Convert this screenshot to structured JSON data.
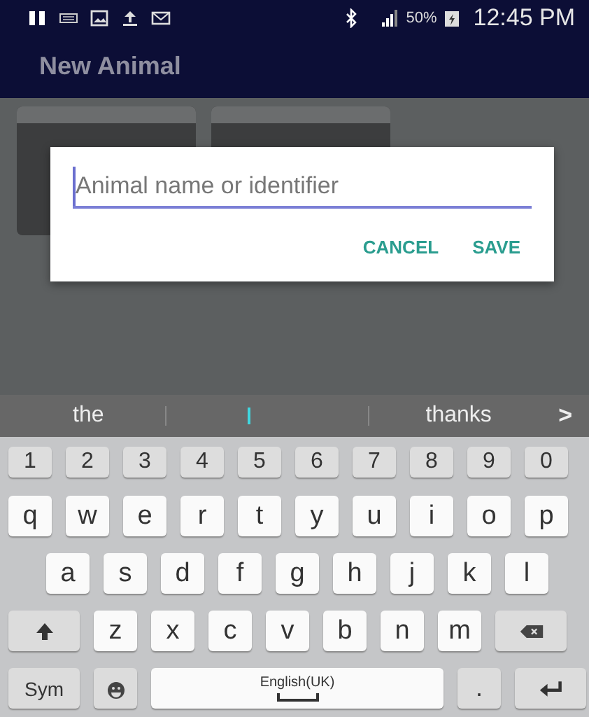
{
  "status_bar": {
    "battery_text": "50%",
    "time": "12:45 PM"
  },
  "app_bar": {
    "title": "New Animal"
  },
  "dialog": {
    "field": {
      "placeholder": "Animal name or identifier",
      "focused": true
    },
    "buttons": [
      "CANCEL",
      "SAVE"
    ]
  },
  "suggestions": {
    "items": [
      "the",
      "thanks"
    ],
    "more": ">"
  },
  "keyboard": {
    "rows": [
      {
        "kind": "numbers",
        "keys": [
          {
            "kind": "char",
            "label": "1"
          },
          {
            "kind": "char",
            "label": "2"
          },
          {
            "kind": "char",
            "label": "3"
          },
          {
            "kind": "char",
            "label": "4"
          },
          {
            "kind": "char",
            "label": "5"
          },
          {
            "kind": "char",
            "label": "6"
          },
          {
            "kind": "char",
            "label": "7"
          },
          {
            "kind": "char",
            "label": "8"
          },
          {
            "kind": "char",
            "label": "9"
          },
          {
            "kind": "char",
            "label": "0"
          }
        ]
      },
      {
        "kind": "letters",
        "keys": [
          {
            "kind": "char",
            "label": "q"
          },
          {
            "kind": "char",
            "label": "w"
          },
          {
            "kind": "char",
            "label": "e"
          },
          {
            "kind": "char",
            "label": "r"
          },
          {
            "kind": "char",
            "label": "t"
          },
          {
            "kind": "char",
            "label": "y"
          },
          {
            "kind": "char",
            "label": "u"
          },
          {
            "kind": "char",
            "label": "i"
          },
          {
            "kind": "char",
            "label": "o"
          },
          {
            "kind": "char",
            "label": "p"
          }
        ]
      },
      {
        "kind": "letters",
        "keys": [
          {
            "kind": "char",
            "label": "a"
          },
          {
            "kind": "char",
            "label": "s"
          },
          {
            "kind": "char",
            "label": "d"
          },
          {
            "kind": "char",
            "label": "f"
          },
          {
            "kind": "char",
            "label": "g"
          },
          {
            "kind": "char",
            "label": "h"
          },
          {
            "kind": "char",
            "label": "j"
          },
          {
            "kind": "char",
            "label": "k"
          },
          {
            "kind": "char",
            "label": "l"
          }
        ]
      },
      {
        "kind": "letters",
        "keys": [
          {
            "kind": "shift"
          },
          {
            "kind": "char",
            "label": "z"
          },
          {
            "kind": "char",
            "label": "x"
          },
          {
            "kind": "char",
            "label": "c"
          },
          {
            "kind": "char",
            "label": "v"
          },
          {
            "kind": "char",
            "label": "b"
          },
          {
            "kind": "char",
            "label": "n"
          },
          {
            "kind": "char",
            "label": "m"
          },
          {
            "kind": "backspace"
          }
        ]
      },
      {
        "kind": "letters",
        "keys": [
          {
            "kind": "sym",
            "label": "Sym"
          },
          {
            "kind": "emoji"
          },
          {
            "kind": "space",
            "label": "English(UK)"
          },
          {
            "kind": "period",
            "label": "."
          },
          {
            "kind": "enter"
          }
        ]
      }
    ]
  }
}
